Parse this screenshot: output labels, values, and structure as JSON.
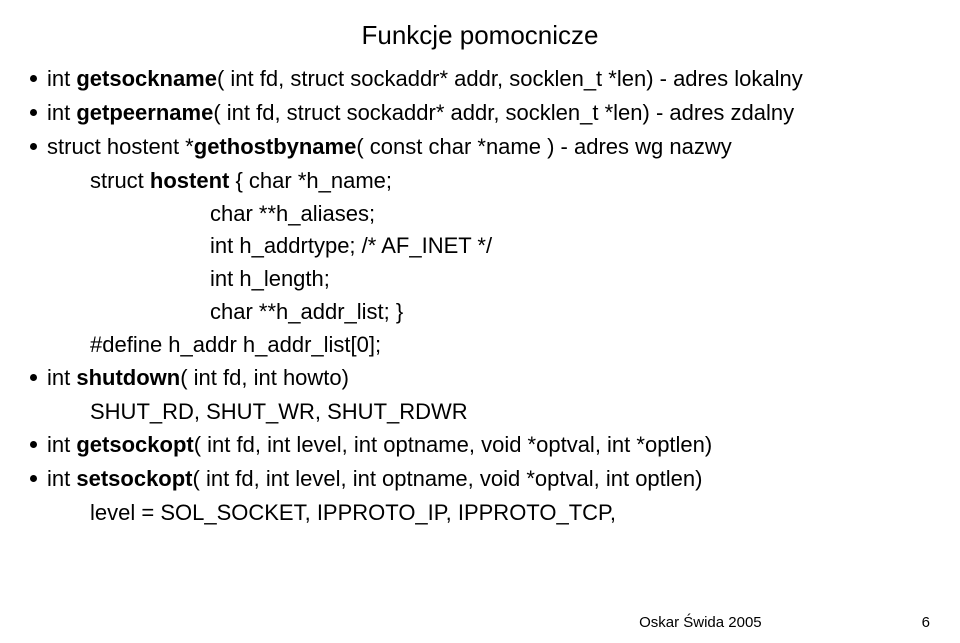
{
  "title": "Funkcje pomocnicze",
  "lines": {
    "l1a": "int ",
    "l1b": "getsockname",
    "l1c": "( int fd, struct sockaddr* addr, socklen_t *len)  - adres lokalny",
    "l2a": "int ",
    "l2b": "getpeername",
    "l2c": "( int fd, struct sockaddr* addr, socklen_t *len)  - adres zdalny",
    "l3a": "struct hostent *",
    "l3b": "gethostbyname",
    "l3c": "( const char *name ) - adres wg nazwy",
    "l4a": "struct ",
    "l4b": "hostent",
    "l4c": " {   char *h_name;",
    "l5": "char **h_aliases;",
    "l6": "int h_addrtype; /* AF_INET */",
    "l7": "int h_length;",
    "l8": "char **h_addr_list; }",
    "l9": "#define h_addr h_addr_list[0];",
    "l10a": "int ",
    "l10b": "shutdown",
    "l10c": "( int fd, int howto)",
    "l11": "SHUT_RD, SHUT_WR, SHUT_RDWR",
    "l12a": "int ",
    "l12b": "getsockopt",
    "l12c": "( int fd, int level, int optname, void *optval, int *optlen)",
    "l13a": "int ",
    "l13b": "setsockopt",
    "l13c": "( int fd, int level, int optname, void *optval, int optlen)",
    "l14": "level = SOL_SOCKET, IPPROTO_IP, IPPROTO_TCP,"
  },
  "footer": {
    "center": "Oskar Świda 2005",
    "right": "6"
  }
}
